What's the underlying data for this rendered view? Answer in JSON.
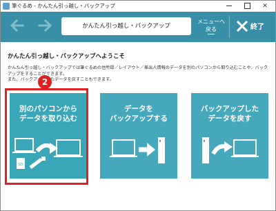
{
  "window": {
    "title": "筆ぐるめ - かんたん引っ越し・バックアップ",
    "icons": {
      "app": "app-icon",
      "minimize": "minimize-icon",
      "maximize": "maximize-icon",
      "close": "close-icon"
    }
  },
  "toolbar": {
    "back_icon": "arrow-left-icon",
    "forward_icon": "arrow-right-icon",
    "title": "かんたん引っ越し・バックアップ",
    "menu_back_line1": "メニューへ",
    "menu_back_line2": "戻る",
    "exit_label": "終了",
    "exit_icon": "x-icon",
    "background_color": "#3a8fa8"
  },
  "main": {
    "heading": "かんたん引っ越し・バックアップへようこそ",
    "description_line1": "かんたん引っ越し・バックアップでは筆ぐるめの住所録／レイアウト／差出人情報のデータを別のパソコンから取り込むことや、バックアップをすることができます。",
    "description_line2": "また、バックアップしたデータを戻すこともできます。"
  },
  "cards": [
    {
      "line1": "別のパソコンから",
      "line2": "データを取り込む",
      "icon": "transfer-laptops-icon"
    },
    {
      "line1": "データを",
      "line2": "バックアップする",
      "icon": "backup-icon"
    },
    {
      "line1": "バックアップした",
      "line2": "データを戻す",
      "icon": "restore-icon"
    }
  ],
  "annotation": {
    "step_number": "2",
    "highlight_color": "#e02020"
  }
}
